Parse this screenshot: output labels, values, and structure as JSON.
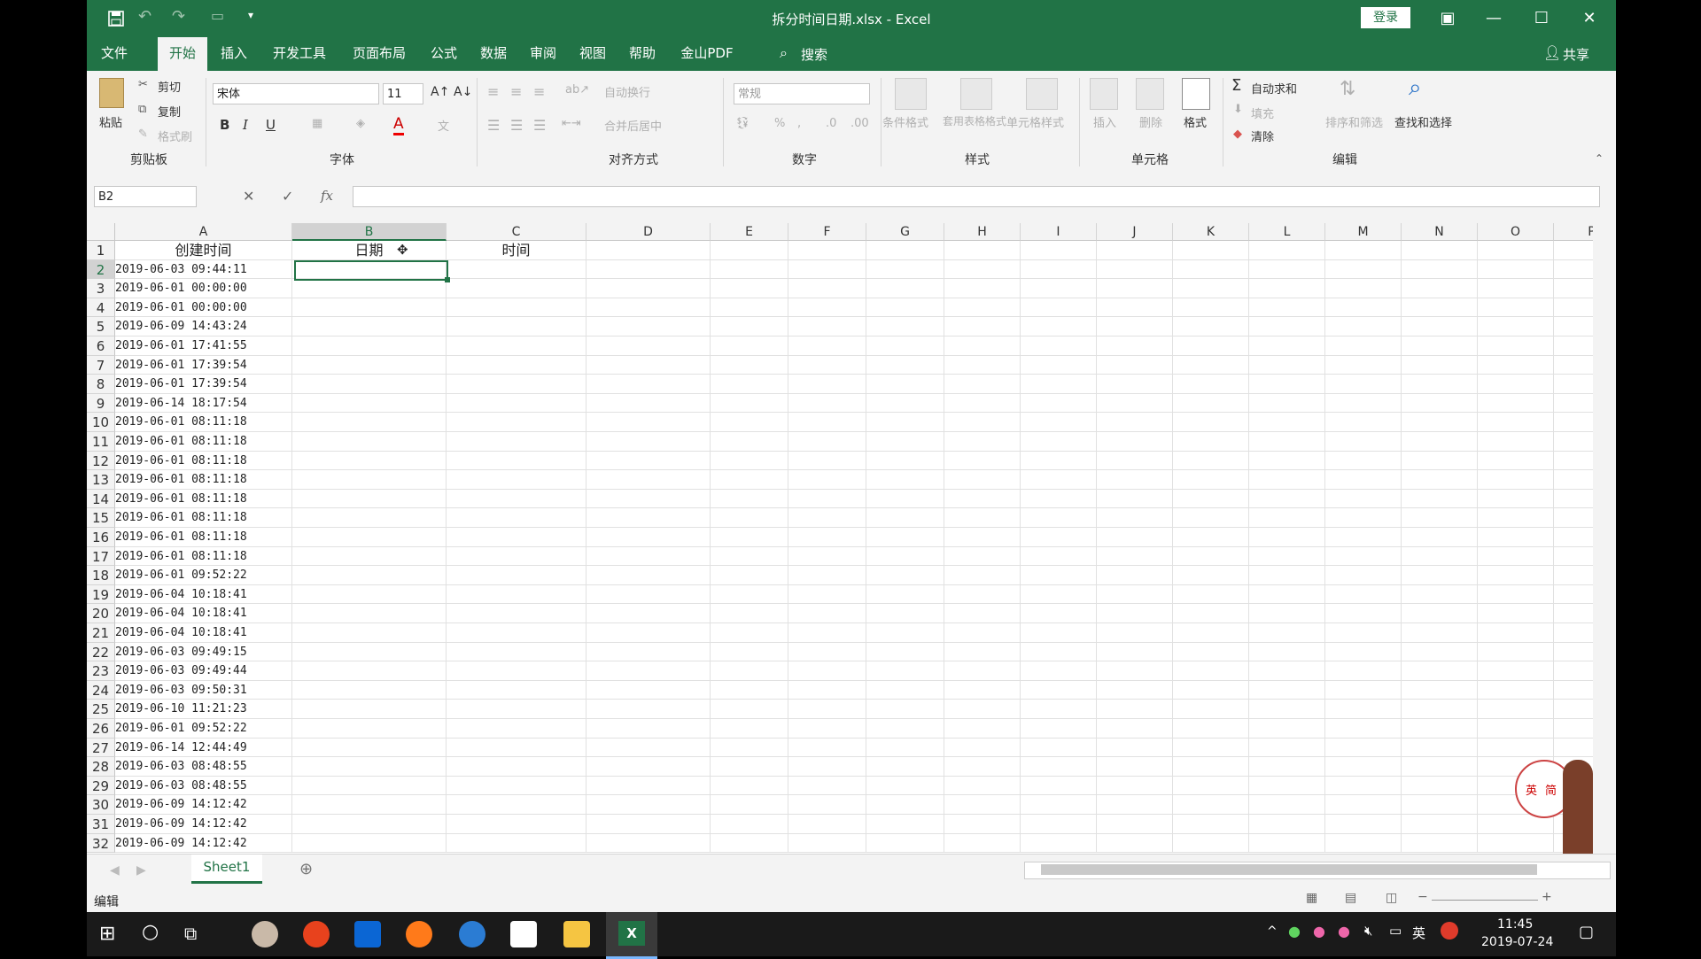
{
  "window": {
    "title": "拆分时间日期.xlsx - Excel",
    "login_label": "登录",
    "share_label": "共享"
  },
  "tabs": [
    "文件",
    "开始",
    "插入",
    "开发工具",
    "页面布局",
    "公式",
    "数据",
    "审阅",
    "视图",
    "帮助",
    "金山PDF"
  ],
  "search_label": "搜索",
  "ribbon": {
    "clipboard": {
      "paste": "粘贴",
      "cut": "剪切",
      "copy": "复制",
      "format_painter": "格式刷",
      "label": "剪贴板"
    },
    "font": {
      "name": "宋体",
      "size": "11",
      "label": "字体",
      "bold": "B",
      "italic": "I",
      "underline": "U"
    },
    "alignment": {
      "wrap": "自动换行",
      "merge": "合并后居中",
      "label": "对齐方式"
    },
    "number": {
      "format": "常规",
      "label": "数字"
    },
    "styles": {
      "conditional": "条件格式",
      "table": "套用表格格式",
      "cell_styles": "单元格样式",
      "label": "样式"
    },
    "cells": {
      "insert": "插入",
      "delete": "删除",
      "format": "格式",
      "label": "单元格"
    },
    "editing": {
      "autosum": "自动求和",
      "fill": "填充",
      "clear": "清除",
      "sort": "排序和筛选",
      "find": "查找和选择",
      "label": "编辑"
    }
  },
  "formula_bar": {
    "name_box": "B2",
    "cancel": "✕",
    "enter": "✓",
    "fx": "fx",
    "content": ""
  },
  "columns": [
    "A",
    "B",
    "C",
    "D",
    "E",
    "F",
    "G",
    "H",
    "I",
    "J",
    "K",
    "L",
    "M",
    "N",
    "O",
    "P"
  ],
  "rows": [
    "1",
    "2",
    "3",
    "4",
    "5",
    "6",
    "7",
    "8",
    "9",
    "10",
    "11",
    "12",
    "13",
    "14",
    "15",
    "16",
    "17",
    "18",
    "19",
    "20",
    "21",
    "22",
    "23",
    "24",
    "25",
    "26",
    "27",
    "28",
    "29",
    "30",
    "31",
    "32"
  ],
  "headers": {
    "a1": "创建时间",
    "b1": "日期",
    "c1": "时间"
  },
  "col_a_values": [
    "2019-06-03 09:44:11",
    "2019-06-01 00:00:00",
    "2019-06-01 00:00:00",
    "2019-06-09 14:43:24",
    "2019-06-01 17:41:55",
    "2019-06-01 17:39:54",
    "2019-06-01 17:39:54",
    "2019-06-14 18:17:54",
    "2019-06-01 08:11:18",
    "2019-06-01 08:11:18",
    "2019-06-01 08:11:18",
    "2019-06-01 08:11:18",
    "2019-06-01 08:11:18",
    "2019-06-01 08:11:18",
    "2019-06-01 08:11:18",
    "2019-06-01 08:11:18",
    "2019-06-01 09:52:22",
    "2019-06-04 10:18:41",
    "2019-06-04 10:18:41",
    "2019-06-04 10:18:41",
    "2019-06-03 09:49:15",
    "2019-06-03 09:49:44",
    "2019-06-03 09:50:31",
    "2019-06-10 11:21:23",
    "2019-06-01 09:52:22",
    "2019-06-14 12:44:49",
    "2019-06-03 08:48:55",
    "2019-06-03 08:48:55",
    "2019-06-09 14:12:42",
    "2019-06-09 14:12:42",
    "2019-06-09 14:12:42"
  ],
  "sheet_tab": "Sheet1",
  "status": "编辑",
  "ime": {
    "lang": "英",
    "mode": "简",
    "tray_lang": "英"
  },
  "clock": {
    "time": "11:45",
    "date": "2019-07-24"
  },
  "colors": {
    "excel_green": "#217346",
    "taskbar": "#1a1a1a"
  }
}
